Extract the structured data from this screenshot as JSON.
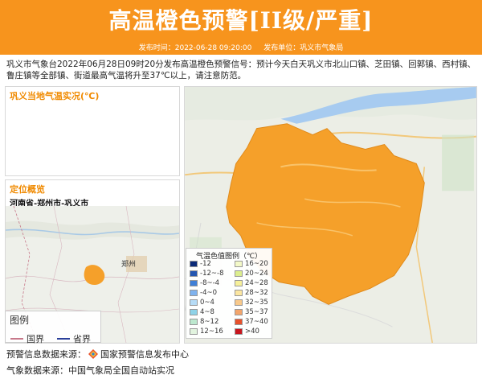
{
  "header": {
    "title": "高温橙色预警[II级/严重]",
    "publish_time_label": "发布时间：2022-06-28 09:20:00",
    "publisher_label": "发布单位：巩义市气象局"
  },
  "notice_text": "巩义市气象台2022年06月28日09时20分发布高温橙色预警信号：预计今天白天巩义市北山口镇、芝田镇、回郭镇、西村镇、鲁庄镇等全部镇、街道最高气温将升至37℃以上，请注意防范。",
  "temperature_panel": {
    "title": "巩义当地气温实况(℃)"
  },
  "location_panel": {
    "title": "定位概览",
    "region": "河南省-郑州市-巩义市",
    "map_city_label": "郑州",
    "legend_title": "图例",
    "legend_items": [
      {
        "label": "国界",
        "color": "#c7788a"
      },
      {
        "label": "省界",
        "color": "#2a3f9a"
      }
    ]
  },
  "temp_legend": {
    "title": "气温色值图例（℃）",
    "left_column": [
      {
        "label": "-12",
        "color": "#0b2a78"
      },
      {
        "label": "-12~-8",
        "color": "#2456b0"
      },
      {
        "label": "-8~-4",
        "color": "#3f7fd6"
      },
      {
        "label": "-4~0",
        "color": "#7fb3ee"
      },
      {
        "label": "0~4",
        "color": "#b6dcf6"
      },
      {
        "label": "4~8",
        "color": "#8fd3e8"
      },
      {
        "label": "8~12",
        "color": "#bde9cf"
      },
      {
        "label": "12~16",
        "color": "#e2f4df"
      }
    ],
    "right_column": [
      {
        "label": "16~20",
        "color": "#f3f9c8"
      },
      {
        "label": "20~24",
        "color": "#dcee8e"
      },
      {
        "label": "24~28",
        "color": "#f6f09a"
      },
      {
        "label": "28~32",
        "color": "#fbe6a0"
      },
      {
        "label": "32~35",
        "color": "#f8c98a"
      },
      {
        "label": "35~37",
        "color": "#f3a56b"
      },
      {
        "label": "37~40",
        "color": "#e8512b"
      },
      {
        "label": ">40",
        "color": "#c8161d"
      }
    ]
  },
  "footer": {
    "source_prefix": "预警信息数据来源：",
    "source_name": "国家预警信息发布中心",
    "weather_source": "气象数据来源：中国气象局全国自动站实况"
  },
  "colors": {
    "banner": "#f7941d",
    "warning_area": "#f5a02a",
    "panel_title": "#f08a00"
  }
}
